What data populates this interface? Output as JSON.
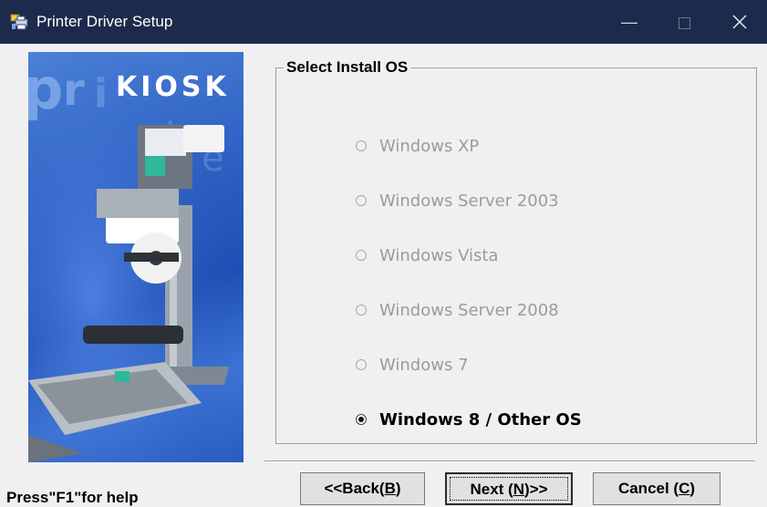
{
  "window": {
    "title": "Printer Driver Setup",
    "controls": {
      "minimize": "—",
      "maximize": "☐",
      "close": "✕"
    },
    "titlebar_color": "#1c2b4c"
  },
  "banner": {
    "brand_text": "KIOSK",
    "watermark": "printer",
    "accent_color": "#2f62c4"
  },
  "group": {
    "title": "Select Install OS",
    "options": [
      {
        "label": "Windows XP",
        "enabled": false,
        "selected": false
      },
      {
        "label": "Windows Server 2003",
        "enabled": false,
        "selected": false
      },
      {
        "label": "Windows Vista",
        "enabled": false,
        "selected": false
      },
      {
        "label": "Windows Server 2008",
        "enabled": false,
        "selected": false
      },
      {
        "label": "Windows 7",
        "enabled": false,
        "selected": false
      },
      {
        "label": "Windows 8 / Other OS",
        "enabled": true,
        "selected": true
      }
    ]
  },
  "footer": {
    "help": "Press\"F1\"for help",
    "back_label_pre": "<<Back(",
    "back_mnemonic": "B",
    "back_label_post": ")",
    "next_label_pre": "Next (",
    "next_mnemonic": "N",
    "next_label_post": ")>>",
    "cancel_label_pre": "Cancel (",
    "cancel_mnemonic": "C",
    "cancel_label_post": ")"
  }
}
